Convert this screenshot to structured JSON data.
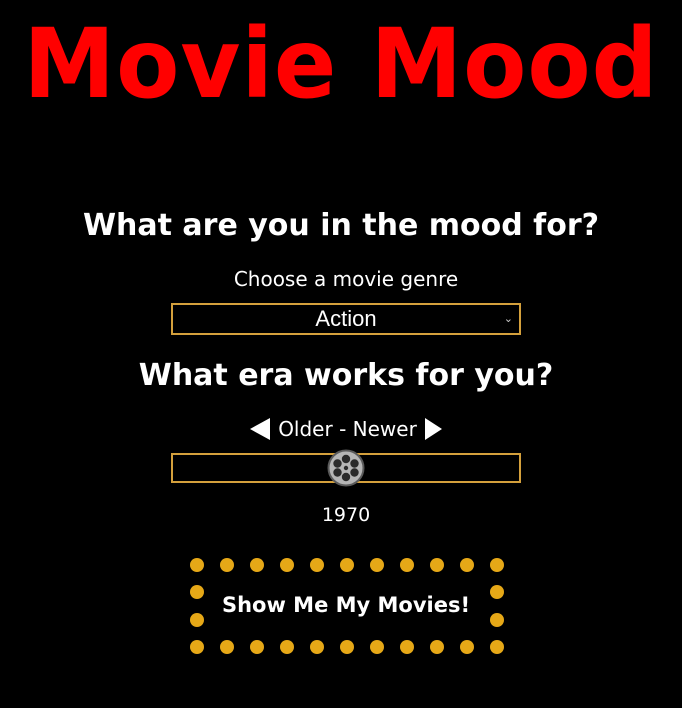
{
  "header": {
    "title": "Movie Mood"
  },
  "genre_section": {
    "heading": "What are you in the mood for?",
    "label": "Choose a movie genre",
    "selected_genre": "Action"
  },
  "era_section": {
    "heading": "What era works for you?",
    "range_label": "Older - Newer",
    "year_value": "1970",
    "slider_position_fraction": 0.5
  },
  "action": {
    "submit_label": "Show Me My Movies!"
  },
  "colors": {
    "title": "#ff0000",
    "accent_border": "#d4a03c",
    "marquee_bulb": "#e6a817",
    "background": "#000000",
    "text": "#ffffff"
  },
  "icons": {
    "slider_thumb": "film-reel-icon",
    "left_arrow": "triangle-left-icon",
    "right_arrow": "triangle-right-icon",
    "select_arrow": "chevron-down-icon"
  }
}
